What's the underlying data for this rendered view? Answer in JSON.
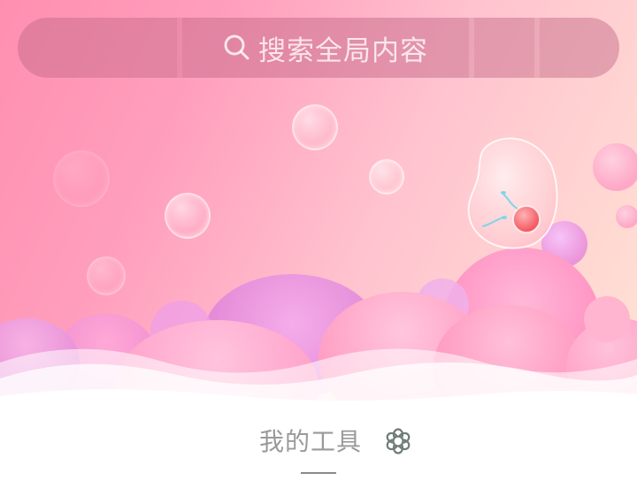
{
  "search": {
    "placeholder": "搜索全局内容",
    "icon": "search-icon"
  },
  "tools": {
    "title": "我的工具",
    "settings_icon": "settings-flower-icon"
  },
  "colors": {
    "hero_start": "#ff8fb0",
    "hero_end": "#ffe3d4",
    "title_text": "#9a9a9a"
  }
}
